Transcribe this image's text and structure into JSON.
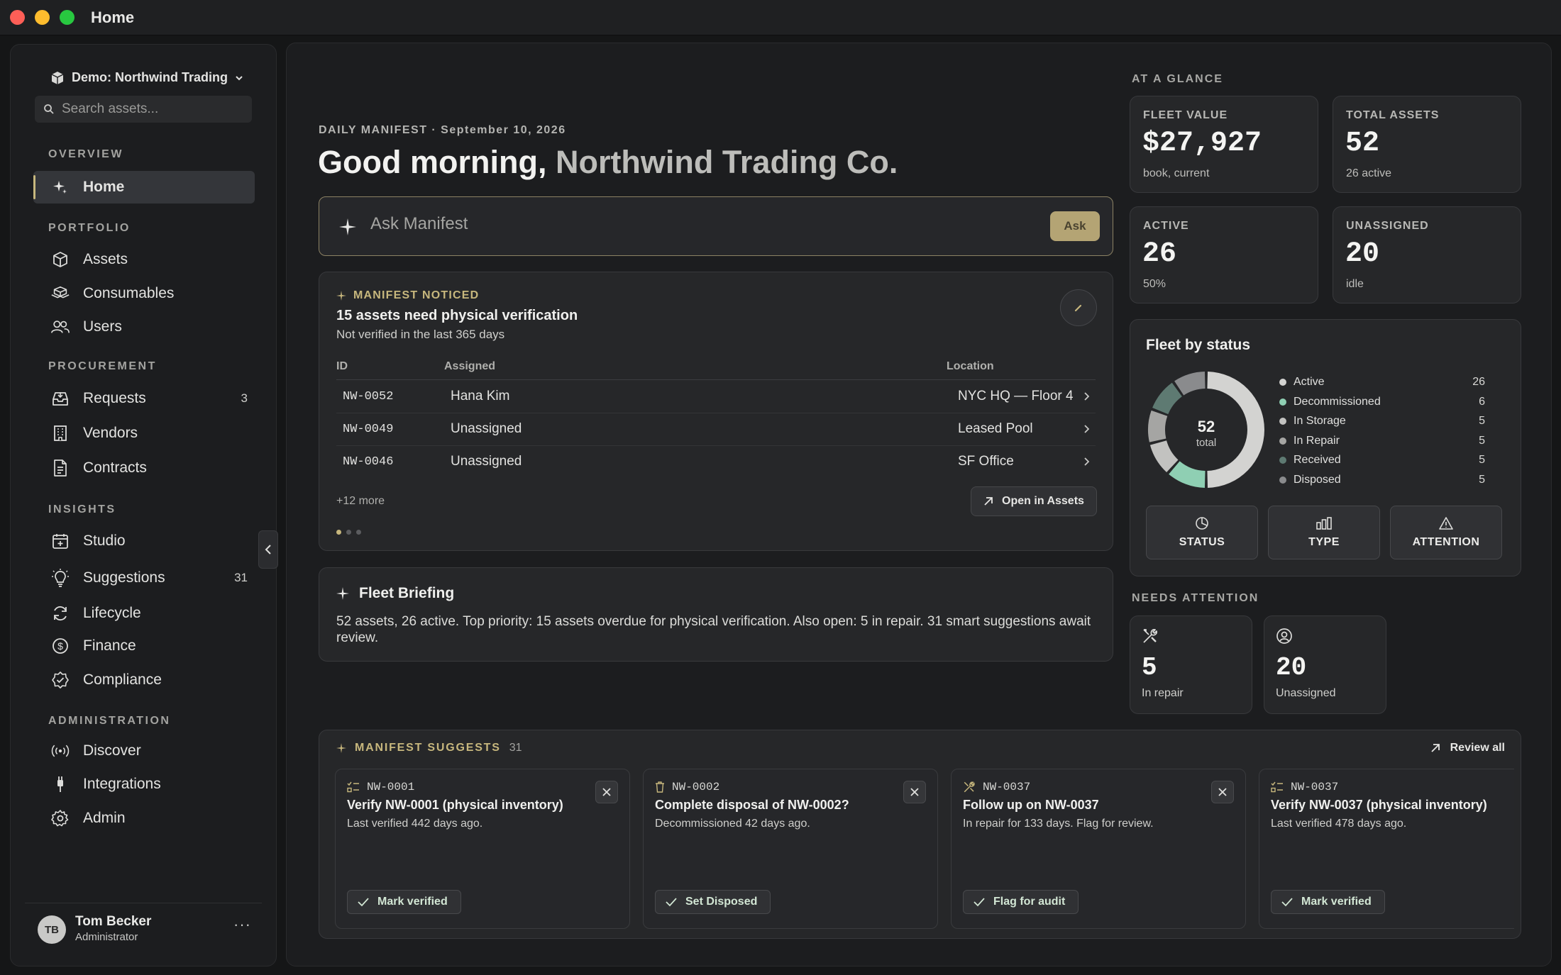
{
  "window": {
    "title": "Home"
  },
  "sidebar": {
    "workspace": "Demo: Northwind Trading",
    "search_placeholder": "Search assets...",
    "sections": {
      "overview": "OVERVIEW",
      "portfolio": "PORTFOLIO",
      "procurement": "PROCUREMENT",
      "insights": "INSIGHTS",
      "administration": "ADMINISTRATION"
    },
    "items": {
      "home": "Home",
      "assets": "Assets",
      "consumables": "Consumables",
      "users": "Users",
      "requests": "Requests",
      "requests_badge": "3",
      "vendors": "Vendors",
      "contracts": "Contracts",
      "studio": "Studio",
      "suggestions": "Suggestions",
      "suggestions_badge": "31",
      "lifecycle": "Lifecycle",
      "finance": "Finance",
      "compliance": "Compliance",
      "discover": "Discover",
      "integrations": "Integrations",
      "admin": "Admin"
    },
    "user": {
      "initials": "TB",
      "name": "Tom Becker",
      "role": "Administrator",
      "more": "···"
    }
  },
  "header": {
    "eyebrow": "DAILY MANIFEST · September 10, 2026",
    "greeting": "Good morning, ",
    "org": "Northwind Trading Co."
  },
  "ask": {
    "placeholder": "Ask Manifest",
    "button": "Ask"
  },
  "noticed": {
    "label": "MANIFEST NOTICED",
    "title": "15 assets need physical verification",
    "subtitle": "Not verified in the last 365 days",
    "columns": {
      "id": "ID",
      "assigned": "Assigned",
      "location": "Location"
    },
    "rows": [
      {
        "id": "NW-0052",
        "assigned": "Hana Kim",
        "location": "NYC HQ — Floor 4"
      },
      {
        "id": "NW-0049",
        "assigned": "Unassigned",
        "location": "Leased Pool"
      },
      {
        "id": "NW-0046",
        "assigned": "Unassigned",
        "location": "SF Office"
      }
    ],
    "more": "+12 more",
    "open_button": "Open in Assets"
  },
  "briefing": {
    "title": "Fleet Briefing",
    "text": "52 assets, 26 active. Top priority: 15 assets overdue for physical verification. Also open: 5 in repair. 31 smart suggestions await review."
  },
  "glance": {
    "label": "AT A GLANCE",
    "stats": [
      {
        "label": "FLEET VALUE",
        "value": "$27,927",
        "sub": "book, current"
      },
      {
        "label": "TOTAL ASSETS",
        "value": "52",
        "sub": "26 active"
      },
      {
        "label": "ACTIVE",
        "value": "26",
        "sub": "50%"
      },
      {
        "label": "UNASSIGNED",
        "value": "20",
        "sub": "idle"
      }
    ]
  },
  "fleet_status": {
    "title": "Fleet by status",
    "total": "52",
    "total_label": "total",
    "legend": [
      {
        "name": "Active",
        "count": 26,
        "color": "#d3d3d1"
      },
      {
        "name": "Decommissioned",
        "count": 6,
        "color": "#8fcfb3"
      },
      {
        "name": "In Storage",
        "count": 5,
        "color": "#c2c2c0"
      },
      {
        "name": "In Repair",
        "count": 5,
        "color": "#a5a5a3"
      },
      {
        "name": "Received",
        "count": 5,
        "color": "#5e7a72"
      },
      {
        "name": "Disposed",
        "count": 5,
        "color": "#8a8b8d"
      }
    ],
    "buttons": {
      "status": "STATUS",
      "type": "TYPE",
      "attention": "ATTENTION"
    }
  },
  "needs_attention": {
    "label": "NEEDS ATTENTION",
    "cards": [
      {
        "value": "5",
        "sub": "In repair"
      },
      {
        "value": "20",
        "sub": "Unassigned"
      }
    ]
  },
  "suggestions": {
    "label": "MANIFEST SUGGESTS",
    "count": "31",
    "review_all": "Review all",
    "cards": [
      {
        "id": "NW-0001",
        "title": "Verify NW-0001 (physical inventory)",
        "desc": "Last verified 442 days ago.",
        "action": "Mark verified"
      },
      {
        "id": "NW-0002",
        "title": "Complete disposal of NW-0002?",
        "desc": "Decommissioned 42 days ago.",
        "action": "Set Disposed"
      },
      {
        "id": "NW-0037",
        "title": "Follow up on NW-0037",
        "desc": "In repair for 133 days. Flag for review.",
        "action": "Flag for audit"
      },
      {
        "id": "NW-0037",
        "title": "Verify NW-0037 (physical inventory)",
        "desc": "Last verified 478 days ago.",
        "action": "Mark verified"
      }
    ]
  },
  "colors": {
    "accent": "#c7b77d",
    "background": "#151617",
    "panel": "#1c1d1f",
    "card": "#262729"
  }
}
